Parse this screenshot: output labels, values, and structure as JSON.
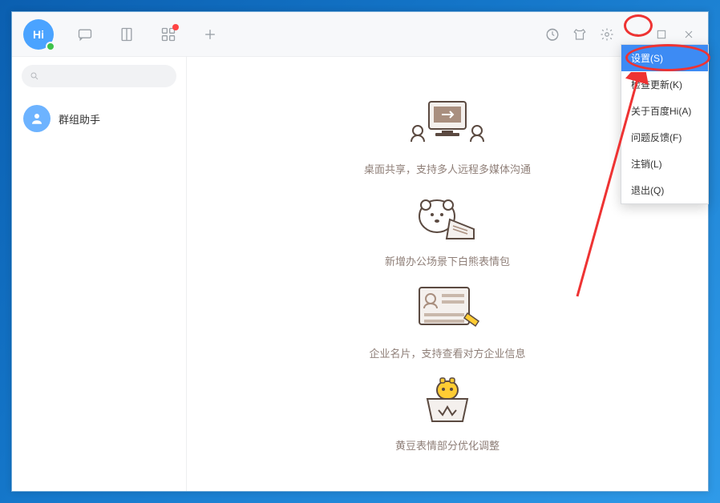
{
  "avatar_text": "Hi",
  "sidebar": {
    "search_placeholder": "",
    "contacts": [
      {
        "name": "群组助手"
      }
    ]
  },
  "features": [
    {
      "caption": "桌面共享，支持多人远程多媒体沟通"
    },
    {
      "caption": "新增办公场景下白熊表情包"
    },
    {
      "caption": "企业名片，支持查看对方企业信息"
    },
    {
      "caption": "黄豆表情部分优化调整"
    }
  ],
  "menu": {
    "items": [
      {
        "label": "设置(S)",
        "active": true
      },
      {
        "label": "检查更新(K)",
        "active": false
      },
      {
        "label": "关于百度Hi(A)",
        "active": false
      },
      {
        "label": "问题反馈(F)",
        "active": false
      },
      {
        "label": "注销(L)",
        "active": false
      },
      {
        "label": "退出(Q)",
        "active": false
      }
    ]
  }
}
